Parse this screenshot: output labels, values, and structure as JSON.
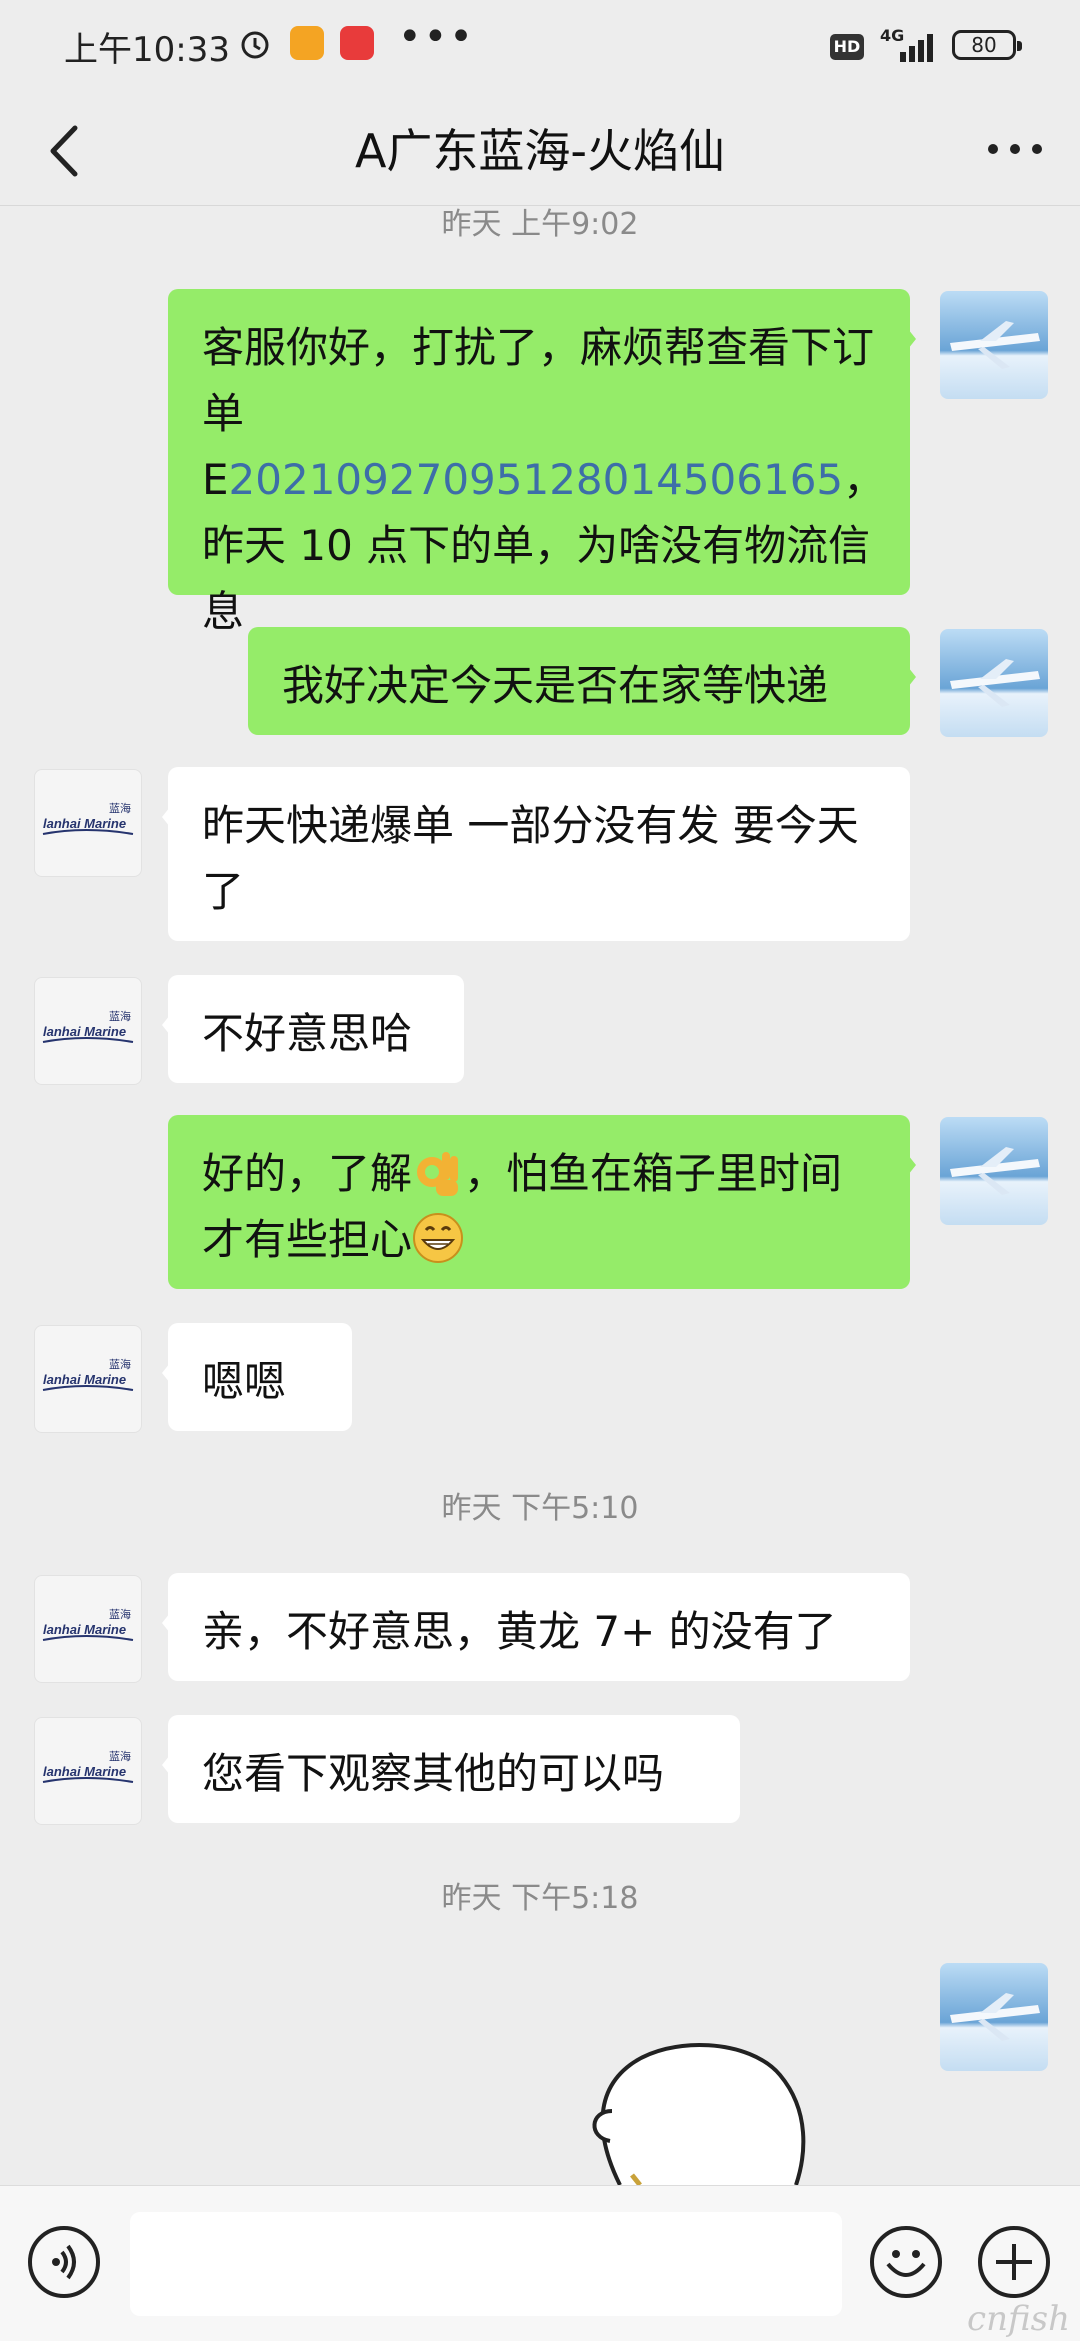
{
  "status_bar": {
    "time": "上午10:33",
    "network": "4G",
    "battery": "80"
  },
  "header": {
    "title": "A广东蓝海-火焰仙"
  },
  "messages": {
    "ts1": "昨天 上午9:02",
    "m1_a": "客服你好，打扰了，麻烦帮查看下订单E",
    "m1_link": "20210927095128014506165",
    "m1_b": "，昨天 10 点下的单，为啥没有物流信息",
    "m2": "我好决定今天是否在家等快递",
    "m3": "昨天快递爆单 一部分没有发  要今天了",
    "m4": "不好意思哈",
    "m5_a": "好的，了解",
    "m5_b": "，怕鱼在箱子里时间才有些担心",
    "m6": "嗯嗯",
    "ts2": "昨天 下午5:10",
    "m7": "亲，不好意思，黄龙 7+ 的没有了",
    "m8": "您看下观察其他的可以吗",
    "ts3": "昨天 下午5:18"
  },
  "avatar_brand": {
    "name": "lanhai Marine",
    "cn": "蓝海"
  },
  "input": {
    "value": ""
  },
  "watermark": "cnfish"
}
